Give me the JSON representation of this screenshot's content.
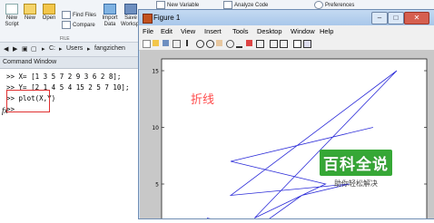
{
  "ribbon": {
    "new_script": "New\nScript",
    "new": "New",
    "open": "Open",
    "find_files": "Find Files",
    "compare": "Compare",
    "import": "Import\nData",
    "save_workspace": "Save\nWorkspace",
    "new_variable": "New Variable",
    "analyze_code": "Analyze Code",
    "preferences": "Preferences",
    "file_group": "FILE"
  },
  "pathbar": {
    "drive": "C:",
    "seg1": "Users",
    "seg2": "fangzichen"
  },
  "command_window": {
    "title": "Command Window",
    "lines": [
      ">> X= [1 3 5 7 2 9 3 6 2 8];",
      ">> Y= [2 1 4 5 4 15 2 5 7 10];",
      ">> plot(X,Y)",
      ">>"
    ],
    "fx": "fx"
  },
  "figure": {
    "title": "Figure 1",
    "menu": [
      "File",
      "Edit",
      "View",
      "Insert",
      "Tools",
      "Desktop",
      "Window",
      "Help"
    ],
    "annotation": "折线",
    "colors": {
      "line": "#2a2ad8",
      "annotation": "#ff4b4b",
      "highlight": "#e03030"
    }
  },
  "chart_data": {
    "type": "line",
    "x": [
      1,
      3,
      5,
      7,
      2,
      9,
      3,
      6,
      2,
      8
    ],
    "series": [
      {
        "values": [
          2,
          1,
          4,
          5,
          4,
          15,
          2,
          5,
          7,
          10
        ]
      }
    ],
    "y_ticks": [
      "15",
      "10",
      "5"
    ],
    "ylim": [
      1,
      15
    ],
    "xlim": [
      1,
      9
    ]
  },
  "watermark": {
    "title": "百科全说",
    "subtitle": "助你轻松解决"
  }
}
